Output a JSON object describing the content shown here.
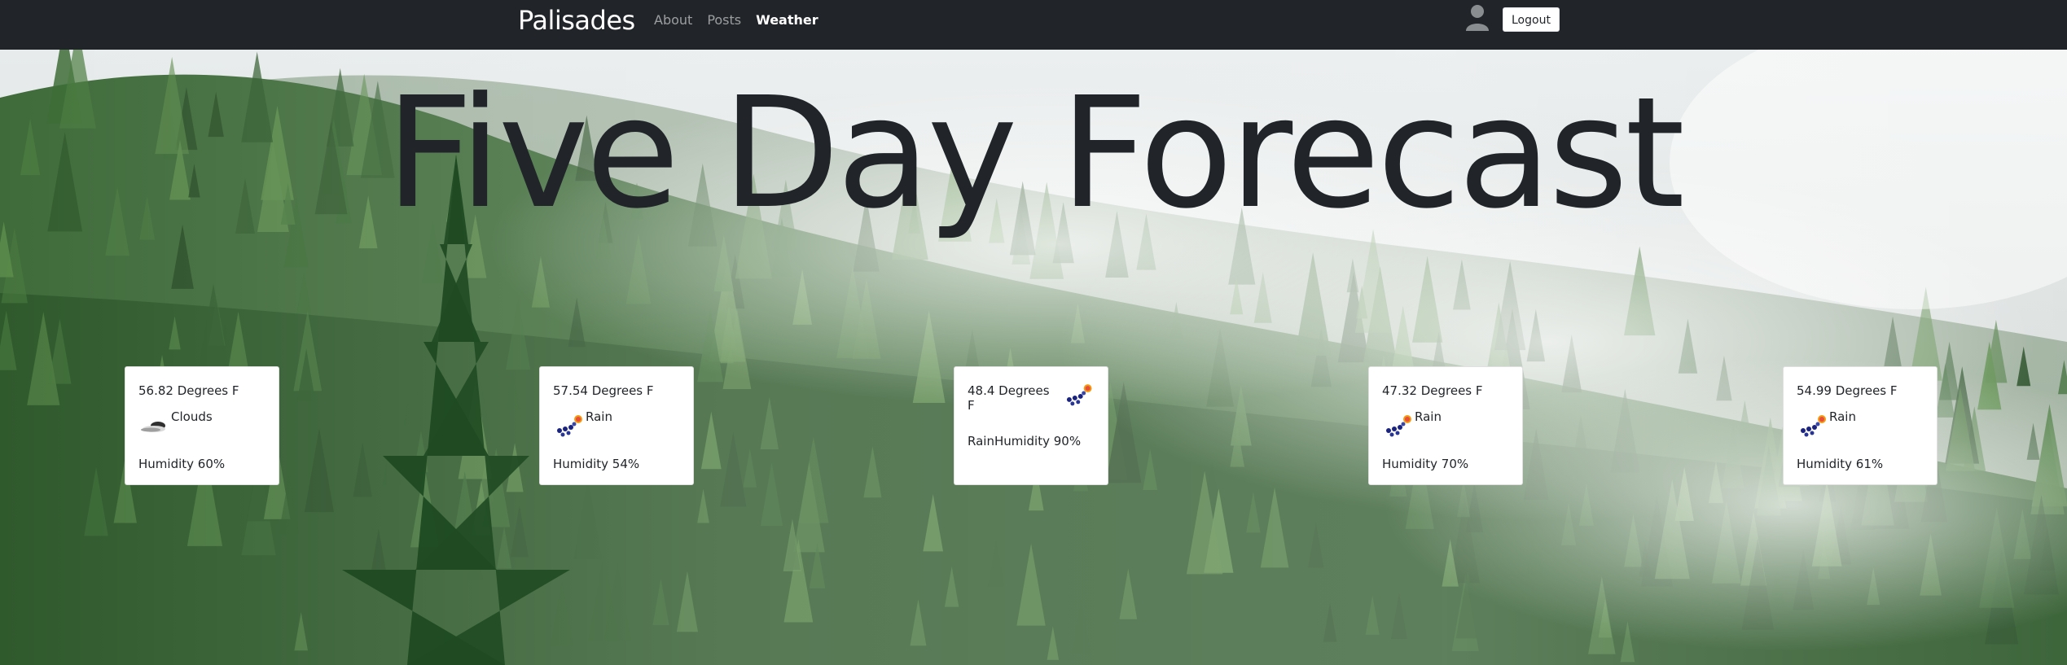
{
  "navbar": {
    "brand": "Palisades",
    "links": [
      {
        "label": "About"
      },
      {
        "label": "Posts"
      },
      {
        "label": "Weather"
      }
    ],
    "logout_label": "Logout"
  },
  "page": {
    "title": "Five Day Forecast"
  },
  "forecast": [
    {
      "temp": "56.82 Degrees F",
      "condition": "Clouds",
      "humidity": "Humidity 60%",
      "icon": "clouds-icon"
    },
    {
      "temp": "57.54 Degrees F",
      "condition": "Rain",
      "humidity": "Humidity 54%",
      "icon": "rain-sun-icon"
    },
    {
      "temp": "48.4 Degrees F",
      "condition": "Rain",
      "humidity": "Humidity 90%",
      "icon": "rain-sun-icon"
    },
    {
      "temp": "47.32 Degrees F",
      "condition": "Rain",
      "humidity": "Humidity 70%",
      "icon": "rain-sun-icon"
    },
    {
      "temp": "54.99 Degrees F",
      "condition": "Rain",
      "humidity": "Humidity 61%",
      "icon": "rain-sun-icon"
    }
  ],
  "colors": {
    "navbar": "#212529",
    "text": "#212529",
    "card": "#ffffff"
  }
}
